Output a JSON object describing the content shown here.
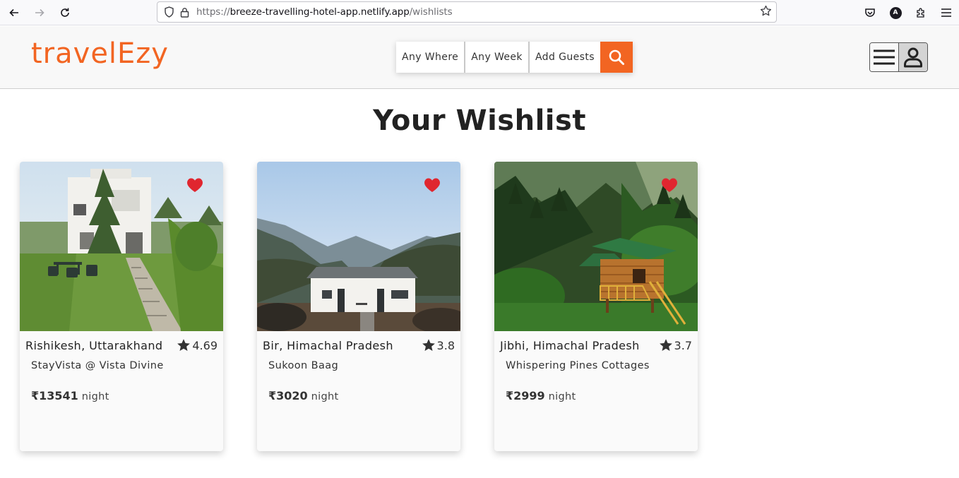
{
  "browser": {
    "url_prefix": "https://",
    "url_host": "breeze-travelling-hotel-app.netlify.app",
    "url_path": "/wishlists",
    "account_initial": "A"
  },
  "header": {
    "logo": "travelEzy",
    "search": {
      "where": "Any Where",
      "week": "Any Week",
      "guests": "Add Guests"
    }
  },
  "page": {
    "title": "Your Wishlist"
  },
  "wishlist": [
    {
      "location": "Rishikesh, Uttarakhand",
      "rating": "4.69",
      "name": "StayVista @ Vista Divine",
      "price": "₹13541",
      "unit": "night"
    },
    {
      "location": "Bir, Himachal Pradesh",
      "rating": "3.8",
      "name": "Sukoon Baag",
      "price": "₹3020",
      "unit": "night"
    },
    {
      "location": "Jibhi, Himachal Pradesh",
      "rating": "3.7",
      "name": "Whispering Pines Cottages",
      "price": "₹2999",
      "unit": "night"
    }
  ],
  "colors": {
    "brand": "#f26522",
    "heart": "#e0262f"
  }
}
